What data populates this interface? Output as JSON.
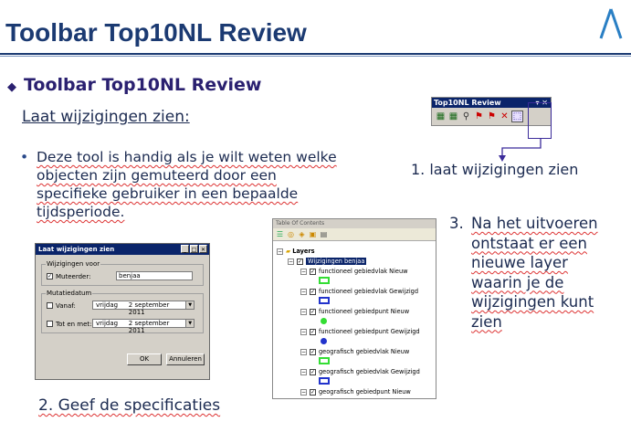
{
  "slide": {
    "title": "Toolbar Top10NL Review",
    "subtitle": "Toolbar Top10NL Review",
    "section_heading": "Laat wijzigingen zien:",
    "body_text": "Deze tool is handig als je wilt weten welke objecten zijn gemuteerd door een specifieke gebruiker in een bepaalde tijdsperiode.",
    "caption_1": "1. laat wijzigingen zien",
    "caption_2": "2. Geef de specificaties",
    "caption_3_num": "3.",
    "caption_3_text": "Na het uitvoeren ontstaat er een nieuwe layer waarin je de wijzigingen kunt zien",
    "colors": {
      "title": "#1b3a72",
      "subtitle": "#2a2070",
      "highlight_box": "#3b2b9a"
    }
  },
  "toolbar": {
    "title": "Top10NL Review",
    "icons": [
      "grid-icon",
      "grid-check-icon",
      "search-flag-icon",
      "flag-icon",
      "flag-prev-icon",
      "flag-x-icon",
      "show-changes-icon"
    ]
  },
  "dialog": {
    "title": "Laat wijzigingen zien",
    "group_changes": "Wijzigingen voor",
    "mutator_label": "Muteerder:",
    "mutator_value": "benjaa",
    "group_date": "Mutatiedatum",
    "from_label": "Vanaf:",
    "until_label": "Tot en met:",
    "from_date_day": "vrijdag",
    "from_date": "2 september 2011",
    "until_date_day": "vrijdag",
    "until_date": "2 september 2011",
    "ok_label": "OK",
    "cancel_label": "Annuleren"
  },
  "toc": {
    "title": "Table Of Contents",
    "root_label": "Layers",
    "group_label": "Wijzigingen benjaa",
    "layers": [
      {
        "label": "functioneel gebiedvlak Nieuw",
        "symbol": "rect",
        "color": "#33dd33"
      },
      {
        "label": "functioneel gebiedvlak Gewijzigd",
        "symbol": "rect",
        "color": "#2233cc"
      },
      {
        "label": "functioneel gebiedpunt Nieuw",
        "symbol": "dot",
        "color": "#33dd33"
      },
      {
        "label": "functioneel gebiedpunt Gewijzigd",
        "symbol": "dot",
        "color": "#2233cc"
      },
      {
        "label": "geografisch gebiedvlak Nieuw",
        "symbol": "rect",
        "color": "#33dd33"
      },
      {
        "label": "geografisch gebiedvlak Gewijzigd",
        "symbol": "rect",
        "color": "#2233cc"
      },
      {
        "label": "geografisch gebiedpunt Nieuw",
        "symbol": "dot",
        "color": "#33dd33"
      }
    ]
  }
}
